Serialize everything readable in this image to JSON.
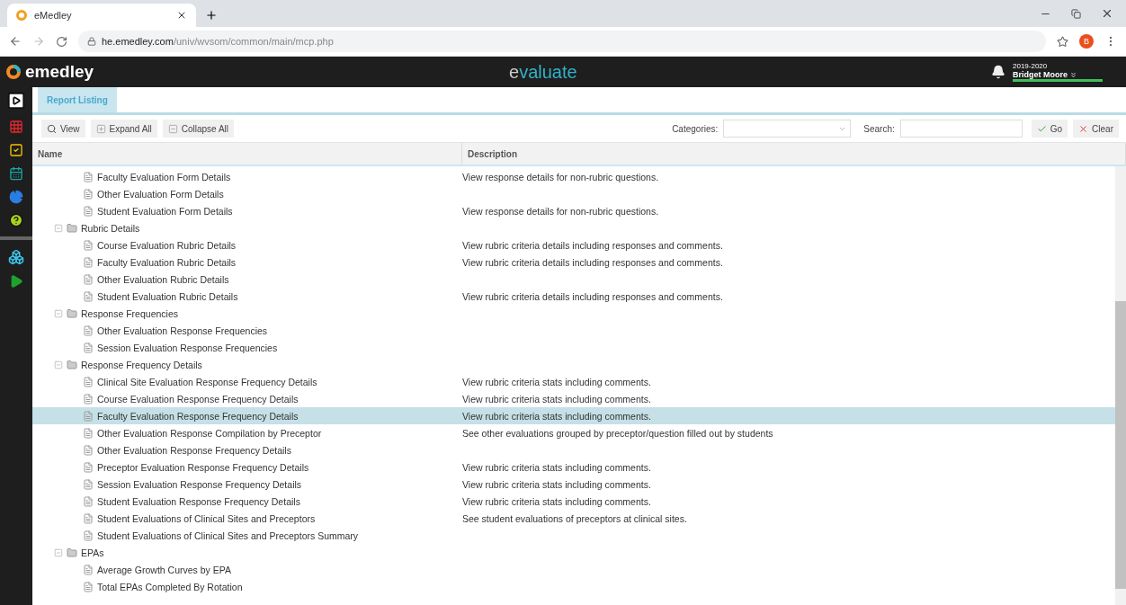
{
  "browser": {
    "tab_title": "eMedley",
    "url_host": "he.emedley.com",
    "url_path": "/univ/wvsom/common/main/mcp.php",
    "profile_initial": "B"
  },
  "header": {
    "brand": "emedley",
    "app_name": "evaluate",
    "year": "2019-2020",
    "user": "Bridget Moore"
  },
  "tabs": [
    {
      "label": "Report Listing",
      "selected": true
    }
  ],
  "toolbar": {
    "buttons": [
      {
        "kind": "view",
        "label": "View"
      },
      {
        "kind": "expand",
        "label": "Expand All"
      },
      {
        "kind": "collapse",
        "label": "Collapse All"
      }
    ],
    "categories_label": "Categories:",
    "search_label": "Search:",
    "go": "Go",
    "clear": "Clear"
  },
  "columns": [
    "Name",
    "Description"
  ],
  "tree": [
    {
      "children": [
        {
          "name": "Faculty Evaluation Form Details",
          "description": "View response details for non-rubric questions.",
          "selected": false
        },
        {
          "name": "Other Evaluation Form Details",
          "selected": false
        },
        {
          "name": "Student Evaluation Form Details",
          "description": "View response details for non-rubric questions.",
          "selected": false
        }
      ]
    },
    {
      "name": "Rubric Details",
      "expanded": true,
      "children": [
        {
          "name": "Course Evaluation Rubric Details",
          "description": "View rubric criteria details including responses and comments.",
          "selected": false
        },
        {
          "name": "Faculty Evaluation Rubric Details",
          "description": "View rubric criteria details including responses and comments.",
          "selected": false
        },
        {
          "name": "Other Evaluation Rubric Details",
          "selected": false
        },
        {
          "name": "Student Evaluation Rubric Details",
          "description": "View rubric criteria details including responses and comments.",
          "selected": false
        }
      ]
    },
    {
      "name": "Response Frequencies",
      "expanded": true,
      "children": [
        {
          "name": "Other Evaluation Response Frequencies",
          "selected": false
        },
        {
          "name": "Session Evaluation Response Frequencies",
          "selected": false
        }
      ]
    },
    {
      "name": "Response Frequency Details",
      "expanded": true,
      "children": [
        {
          "name": "Clinical Site Evaluation Response Frequency Details",
          "description": "View rubric criteria stats including comments.",
          "selected": false
        },
        {
          "name": "Course Evaluation Response Frequency Details",
          "description": "View rubric criteria stats including comments.",
          "selected": false
        },
        {
          "name": "Faculty Evaluation Response Frequency Details",
          "description": "View rubric criteria stats including comments.",
          "selected": true
        },
        {
          "name": "Other Evaluation Response Compilation by Preceptor",
          "description": "See other evaluations grouped by preceptor/question filled out by students",
          "selected": false
        },
        {
          "name": "Other Evaluation Response Frequency Details",
          "selected": false
        },
        {
          "name": "Preceptor Evaluation Response Frequency Details",
          "description": "View rubric criteria stats including comments.",
          "selected": false
        },
        {
          "name": "Session Evaluation Response Frequency Details",
          "description": "View rubric criteria stats including comments.",
          "selected": false
        },
        {
          "name": "Student Evaluation Response Frequency Details",
          "description": "View rubric criteria stats including comments.",
          "selected": false
        },
        {
          "name": "Student Evaluations of Clinical Sites and Preceptors",
          "description": "See student evaluations of preceptors at clinical sites.",
          "selected": false
        },
        {
          "name": "Student Evaluations of Clinical Sites and Preceptors Summary",
          "selected": false
        }
      ]
    },
    {
      "name": "EPAs",
      "expanded": true,
      "children": [
        {
          "name": "Average Growth Curves by EPA",
          "selected": false
        },
        {
          "name": "Total EPAs Completed By Rotation",
          "selected": false
        }
      ]
    }
  ]
}
